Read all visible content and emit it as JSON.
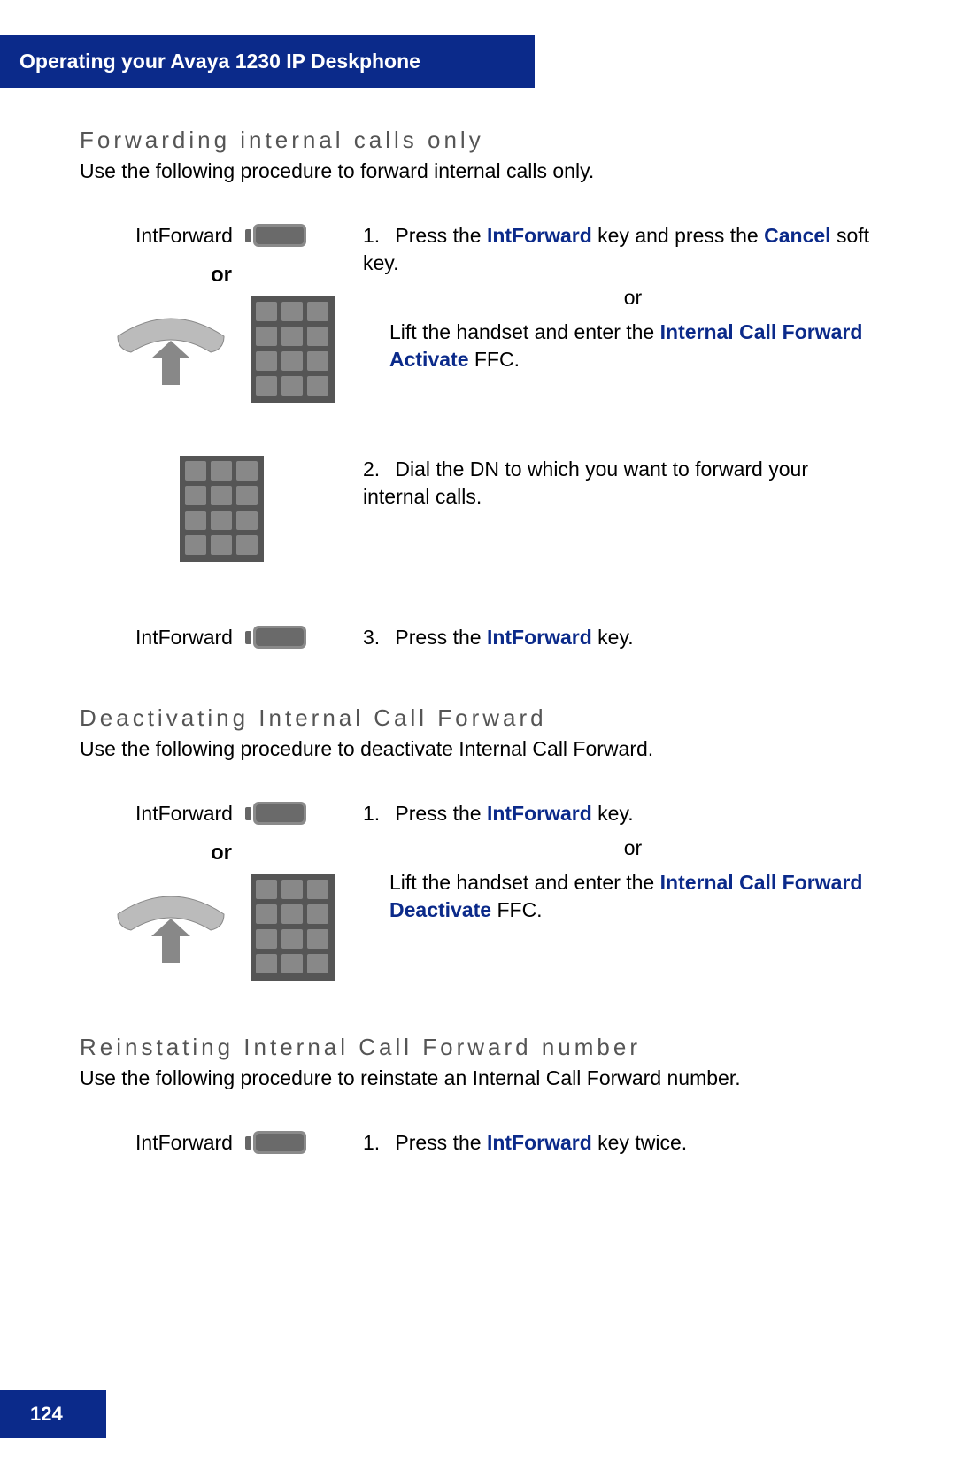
{
  "header": {
    "title": "Operating your Avaya 1230 IP Deskphone"
  },
  "pageNumber": "124",
  "labels": {
    "intForward": "IntForward",
    "or": "or"
  },
  "section1": {
    "title": "Forwarding internal calls only",
    "intro": "Use the following procedure to forward internal calls only.",
    "step1": {
      "num": "1.",
      "t1": "Press the ",
      "h1": "IntForward",
      "t2": " key and press the ",
      "h2": "Cancel",
      "t3": " soft key.",
      "or": "or",
      "t4": "Lift the handset and enter the ",
      "h3": "Internal Call Forward Activate",
      "t5": " FFC."
    },
    "step2": {
      "num": "2.",
      "text": "Dial the DN to which you want to forward your internal calls."
    },
    "step3": {
      "num": "3.",
      "t1": "Press the ",
      "h1": "IntForward",
      "t2": " key."
    }
  },
  "section2": {
    "title": "Deactivating Internal Call Forward",
    "intro": "Use the following procedure to deactivate Internal Call Forward.",
    "step1": {
      "num": "1.",
      "t1": "Press the ",
      "h1": "IntForward",
      "t2": " key.",
      "or": "or",
      "t3": "Lift the handset and enter the ",
      "h2": "Internal Call Forward Deactivate",
      "t4": " FFC."
    }
  },
  "section3": {
    "title": "Reinstating Internal Call Forward number",
    "intro": "Use the following procedure to reinstate an Internal Call Forward number.",
    "step1": {
      "num": "1.",
      "t1": "Press the ",
      "h1": "IntForward",
      "t2": " key twice."
    }
  }
}
